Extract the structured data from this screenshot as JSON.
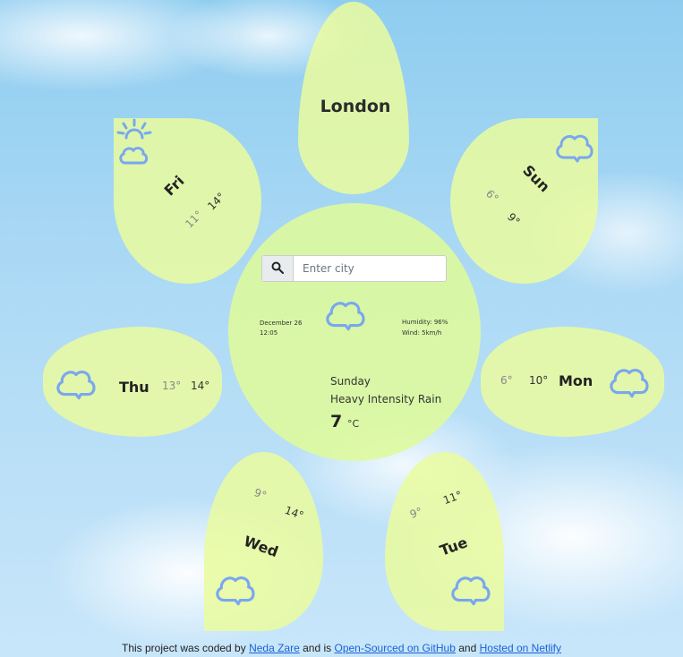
{
  "city": "London",
  "search": {
    "placeholder": "Enter city"
  },
  "current": {
    "date": "December 26",
    "time": "12:05",
    "humidity": "Humidity: 96%",
    "wind": "Wind: 5km/h",
    "day": "Sunday",
    "description": "Heavy Intensity Rain",
    "temperature": "7",
    "unit": "°C",
    "icon": "cloud-icon"
  },
  "forecast": [
    {
      "day": "Fri",
      "min": "11°",
      "max": "14°",
      "icon": "partly-sunny-icon"
    },
    {
      "day": "Sun",
      "min": "6°",
      "max": "9°",
      "icon": "cloud-icon"
    },
    {
      "day": "Thu",
      "min": "13°",
      "max": "14°",
      "icon": "cloud-icon"
    },
    {
      "day": "Mon",
      "min": "6°",
      "max": "10°",
      "icon": "cloud-icon"
    },
    {
      "day": "Wed",
      "min": "9°",
      "max": "14°",
      "icon": "cloud-icon"
    },
    {
      "day": "Tue",
      "min": "9°",
      "max": "11°",
      "icon": "cloud-icon"
    }
  ],
  "footer": {
    "prefix": "This project was coded by ",
    "author": "Neda Zare",
    "middle": " and is ",
    "github": "Open-Sourced on GitHub",
    "and": " and ",
    "netlify": "Hosted on Netlify"
  },
  "colors": {
    "petal": "#eafc9e",
    "icon": "#7aa7ef",
    "link": "#1b61d6"
  }
}
